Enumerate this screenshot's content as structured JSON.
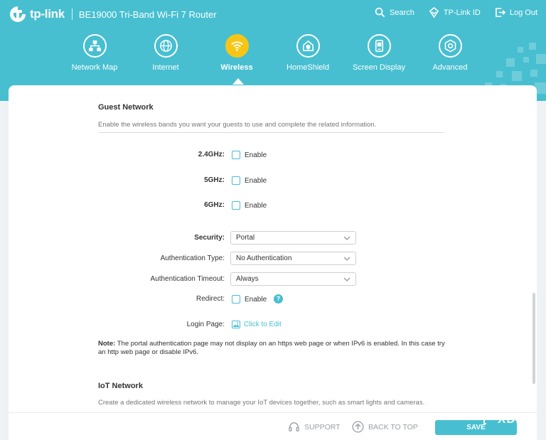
{
  "header": {
    "brand": "tp-link",
    "router_title": "BE19000 Tri-Band Wi-Fi 7 Router",
    "links": [
      {
        "label": "Search",
        "icon": "search-icon"
      },
      {
        "label": "TP-Link ID",
        "icon": "tplink-id-icon"
      },
      {
        "label": "Log Out",
        "icon": "logout-icon"
      }
    ],
    "colors": {
      "primary": "#47bfd0",
      "active": "#f7c615"
    }
  },
  "nav": {
    "active": "Wireless",
    "items": [
      {
        "label": "Network Map",
        "icon": "network-map-icon"
      },
      {
        "label": "Internet",
        "icon": "globe-icon"
      },
      {
        "label": "Wireless",
        "icon": "wifi-icon"
      },
      {
        "label": "HomeShield",
        "icon": "homeshield-icon"
      },
      {
        "label": "Screen Display",
        "icon": "screen-display-icon"
      },
      {
        "label": "Advanced",
        "icon": "gear-icon"
      }
    ]
  },
  "guest": {
    "title": "Guest Network",
    "description": "Enable the wireless bands you want your guests to use and complete the related information.",
    "bands": [
      {
        "label": "2.4GHz:",
        "option": "Enable",
        "checked": false
      },
      {
        "label": "5GHz:",
        "option": "Enable",
        "checked": false
      },
      {
        "label": "6GHz:",
        "option": "Enable",
        "checked": false
      }
    ],
    "security": {
      "label": "Security:",
      "value": "Portal"
    },
    "auth_type": {
      "label": "Authentication Type:",
      "value": "No Authentication"
    },
    "auth_timeout": {
      "label": "Authentication Timeout:",
      "value": "Always"
    },
    "redirect": {
      "label": "Redirect:",
      "option": "Enable",
      "checked": false,
      "help": "?"
    },
    "login_page": {
      "label": "Login Page:",
      "link": "Click to Edit"
    },
    "note_label": "Note:",
    "note_text": " The portal authentication page may not display on an https web page or when IPv6 is enabled. In this case try an http web page or disable IPv6."
  },
  "iot": {
    "title": "IoT Network",
    "description": "Create a dedicated wireless network to manage your IoT devices together, such as smart lights and cameras."
  },
  "footer": {
    "support": "SUPPORT",
    "back_to_top": "BACK TO TOP",
    "save": "SAVE"
  },
  "watermark": "XDA"
}
